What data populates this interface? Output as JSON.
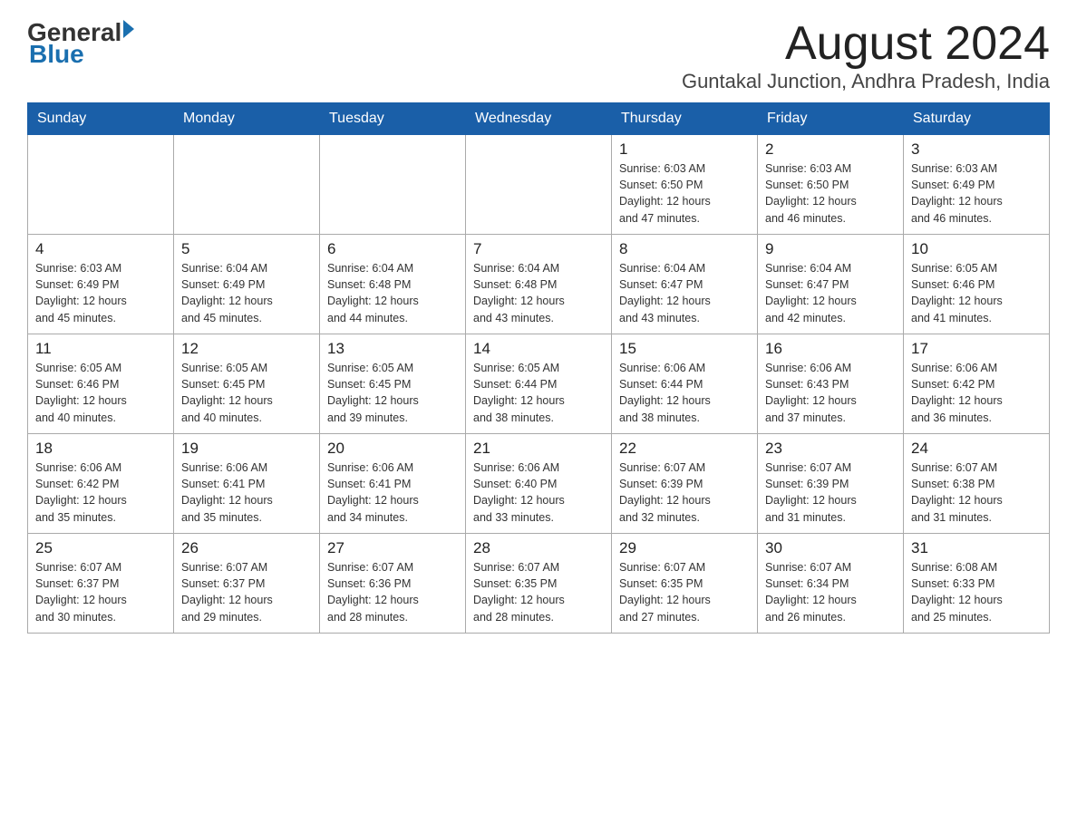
{
  "header": {
    "logo": {
      "general": "General",
      "blue": "Blue",
      "arrow": "►"
    },
    "title": "August 2024",
    "location": "Guntakal Junction, Andhra Pradesh, India"
  },
  "days_of_week": [
    "Sunday",
    "Monday",
    "Tuesday",
    "Wednesday",
    "Thursday",
    "Friday",
    "Saturday"
  ],
  "weeks": [
    [
      {
        "day": "",
        "info": ""
      },
      {
        "day": "",
        "info": ""
      },
      {
        "day": "",
        "info": ""
      },
      {
        "day": "",
        "info": ""
      },
      {
        "day": "1",
        "info": "Sunrise: 6:03 AM\nSunset: 6:50 PM\nDaylight: 12 hours\nand 47 minutes."
      },
      {
        "day": "2",
        "info": "Sunrise: 6:03 AM\nSunset: 6:50 PM\nDaylight: 12 hours\nand 46 minutes."
      },
      {
        "day": "3",
        "info": "Sunrise: 6:03 AM\nSunset: 6:49 PM\nDaylight: 12 hours\nand 46 minutes."
      }
    ],
    [
      {
        "day": "4",
        "info": "Sunrise: 6:03 AM\nSunset: 6:49 PM\nDaylight: 12 hours\nand 45 minutes."
      },
      {
        "day": "5",
        "info": "Sunrise: 6:04 AM\nSunset: 6:49 PM\nDaylight: 12 hours\nand 45 minutes."
      },
      {
        "day": "6",
        "info": "Sunrise: 6:04 AM\nSunset: 6:48 PM\nDaylight: 12 hours\nand 44 minutes."
      },
      {
        "day": "7",
        "info": "Sunrise: 6:04 AM\nSunset: 6:48 PM\nDaylight: 12 hours\nand 43 minutes."
      },
      {
        "day": "8",
        "info": "Sunrise: 6:04 AM\nSunset: 6:47 PM\nDaylight: 12 hours\nand 43 minutes."
      },
      {
        "day": "9",
        "info": "Sunrise: 6:04 AM\nSunset: 6:47 PM\nDaylight: 12 hours\nand 42 minutes."
      },
      {
        "day": "10",
        "info": "Sunrise: 6:05 AM\nSunset: 6:46 PM\nDaylight: 12 hours\nand 41 minutes."
      }
    ],
    [
      {
        "day": "11",
        "info": "Sunrise: 6:05 AM\nSunset: 6:46 PM\nDaylight: 12 hours\nand 40 minutes."
      },
      {
        "day": "12",
        "info": "Sunrise: 6:05 AM\nSunset: 6:45 PM\nDaylight: 12 hours\nand 40 minutes."
      },
      {
        "day": "13",
        "info": "Sunrise: 6:05 AM\nSunset: 6:45 PM\nDaylight: 12 hours\nand 39 minutes."
      },
      {
        "day": "14",
        "info": "Sunrise: 6:05 AM\nSunset: 6:44 PM\nDaylight: 12 hours\nand 38 minutes."
      },
      {
        "day": "15",
        "info": "Sunrise: 6:06 AM\nSunset: 6:44 PM\nDaylight: 12 hours\nand 38 minutes."
      },
      {
        "day": "16",
        "info": "Sunrise: 6:06 AM\nSunset: 6:43 PM\nDaylight: 12 hours\nand 37 minutes."
      },
      {
        "day": "17",
        "info": "Sunrise: 6:06 AM\nSunset: 6:42 PM\nDaylight: 12 hours\nand 36 minutes."
      }
    ],
    [
      {
        "day": "18",
        "info": "Sunrise: 6:06 AM\nSunset: 6:42 PM\nDaylight: 12 hours\nand 35 minutes."
      },
      {
        "day": "19",
        "info": "Sunrise: 6:06 AM\nSunset: 6:41 PM\nDaylight: 12 hours\nand 35 minutes."
      },
      {
        "day": "20",
        "info": "Sunrise: 6:06 AM\nSunset: 6:41 PM\nDaylight: 12 hours\nand 34 minutes."
      },
      {
        "day": "21",
        "info": "Sunrise: 6:06 AM\nSunset: 6:40 PM\nDaylight: 12 hours\nand 33 minutes."
      },
      {
        "day": "22",
        "info": "Sunrise: 6:07 AM\nSunset: 6:39 PM\nDaylight: 12 hours\nand 32 minutes."
      },
      {
        "day": "23",
        "info": "Sunrise: 6:07 AM\nSunset: 6:39 PM\nDaylight: 12 hours\nand 31 minutes."
      },
      {
        "day": "24",
        "info": "Sunrise: 6:07 AM\nSunset: 6:38 PM\nDaylight: 12 hours\nand 31 minutes."
      }
    ],
    [
      {
        "day": "25",
        "info": "Sunrise: 6:07 AM\nSunset: 6:37 PM\nDaylight: 12 hours\nand 30 minutes."
      },
      {
        "day": "26",
        "info": "Sunrise: 6:07 AM\nSunset: 6:37 PM\nDaylight: 12 hours\nand 29 minutes."
      },
      {
        "day": "27",
        "info": "Sunrise: 6:07 AM\nSunset: 6:36 PM\nDaylight: 12 hours\nand 28 minutes."
      },
      {
        "day": "28",
        "info": "Sunrise: 6:07 AM\nSunset: 6:35 PM\nDaylight: 12 hours\nand 28 minutes."
      },
      {
        "day": "29",
        "info": "Sunrise: 6:07 AM\nSunset: 6:35 PM\nDaylight: 12 hours\nand 27 minutes."
      },
      {
        "day": "30",
        "info": "Sunrise: 6:07 AM\nSunset: 6:34 PM\nDaylight: 12 hours\nand 26 minutes."
      },
      {
        "day": "31",
        "info": "Sunrise: 6:08 AM\nSunset: 6:33 PM\nDaylight: 12 hours\nand 25 minutes."
      }
    ]
  ],
  "colors": {
    "header_bg": "#1a5fa8",
    "header_text": "#ffffff",
    "border": "#aaaaaa"
  }
}
